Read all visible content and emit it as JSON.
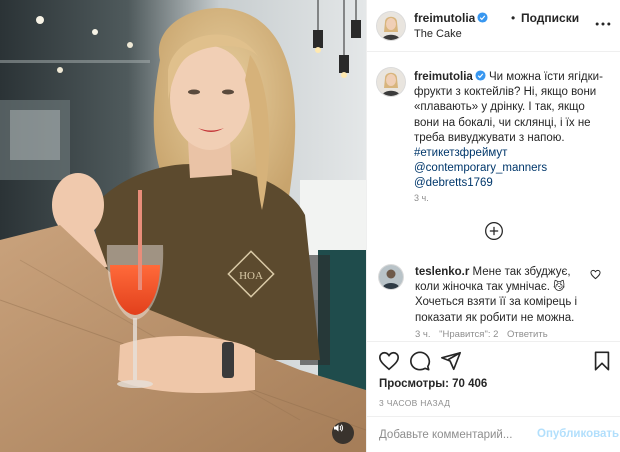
{
  "post": {
    "author": "freimutolia",
    "verified": true,
    "header_separator": "•",
    "follow_label": "Подписки",
    "location": "The Cake",
    "more_icon": "more-horizontal-icon",
    "sound_icon": "volume-icon"
  },
  "caption": {
    "username": "freimutolia",
    "text": "Чи можна їсти ягідки-фрукти з коктейлів? Ні, якщо вони «плавають» у дрінку. І так, якщо вони на бокалі, чи склянці, і їх не треба вивуджувати з напою.",
    "hashtag": "#етикетзфреймут",
    "mentions": [
      "@contemporary_manners",
      "@debretts1769"
    ],
    "time": "3 ч."
  },
  "load_more_icon": "plus-circle-icon",
  "comments": [
    {
      "username": "teslenko.r",
      "text": "Мене так збуджує, коли жіночка так умнічає. 😼 Хочеться взяти її за комірець і показати як робити не можна.",
      "time": "3 ч.",
      "likes": "\"Нравится\": 2",
      "reply": "Ответить"
    }
  ],
  "actions": {
    "icons": [
      "heart-icon",
      "comment-icon",
      "share-icon",
      "bookmark-icon"
    ],
    "views_label": "Просмотры: 70 406",
    "posted_ago": "3 ЧАСОВ НАЗАД"
  },
  "comment_input": {
    "placeholder": "Добавьте комментарий...",
    "publish_label": "Опубликовать"
  },
  "colors": {
    "link": "#00376b",
    "publish_disabled": "#b2dffc",
    "verified": "#3897f0",
    "border": "#efefef",
    "muted": "#8e8e8e"
  }
}
